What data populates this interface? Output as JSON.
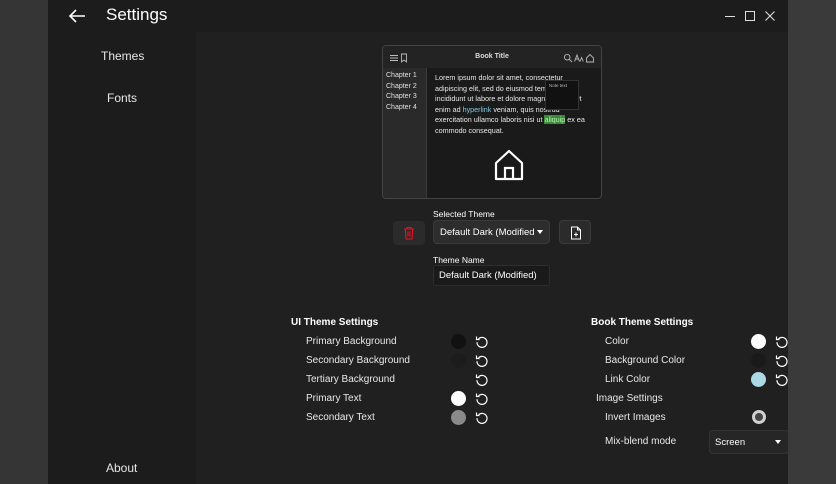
{
  "window": {
    "title": "Settings"
  },
  "sidebar": {
    "items": [
      {
        "label": "Themes"
      },
      {
        "label": "Fonts"
      }
    ],
    "footer": {
      "label": "About"
    }
  },
  "preview": {
    "book_title": "Book Title",
    "chapters": [
      "Chapter 1",
      "Chapter 2",
      "Chapter 3",
      "Chapter 4"
    ],
    "text_1": "Lorem ipsum dolor sit amet, consectetur adipiscing elit, sed do eiusmod tempor incididunt ut labore et dolore magna aliqua. Ut enim ad ",
    "link_text": "hyperlink",
    "text_2": " veniam, quis nostrud exercitation ullamco laboris nisi ut ",
    "highlight_text": "aliquip",
    "text_3": " ex ea commodo consequat.",
    "note_text": "Note text"
  },
  "theme": {
    "selected_label": "Selected Theme",
    "selected_value": "Default Dark (Modified)",
    "name_label": "Theme Name",
    "name_value": "Default Dark (Modified)"
  },
  "ui_theme": {
    "title": "UI Theme Settings",
    "rows": [
      {
        "label": "Primary Background",
        "color": "#111111"
      },
      {
        "label": "Secondary Background",
        "color": "#1c1c1c"
      },
      {
        "label": "Tertiary Background",
        "color": "#202020"
      },
      {
        "label": "Primary Text",
        "color": "#ffffff"
      },
      {
        "label": "Secondary Text",
        "color": "#8a8a8a"
      }
    ]
  },
  "book_theme": {
    "title": "Book Theme Settings",
    "rows": [
      {
        "label": "Color",
        "color": "#ffffff"
      },
      {
        "label": "Background Color",
        "color": "#1a1a1a"
      },
      {
        "label": "Link Color",
        "color": "#add8e6"
      }
    ],
    "image_settings_label": "Image Settings",
    "invert_label": "Invert Images",
    "blend_label": "Mix-blend mode",
    "blend_value": "Screen"
  },
  "colors": {
    "delete_icon": "#e81123",
    "accent": "#ffffff"
  }
}
